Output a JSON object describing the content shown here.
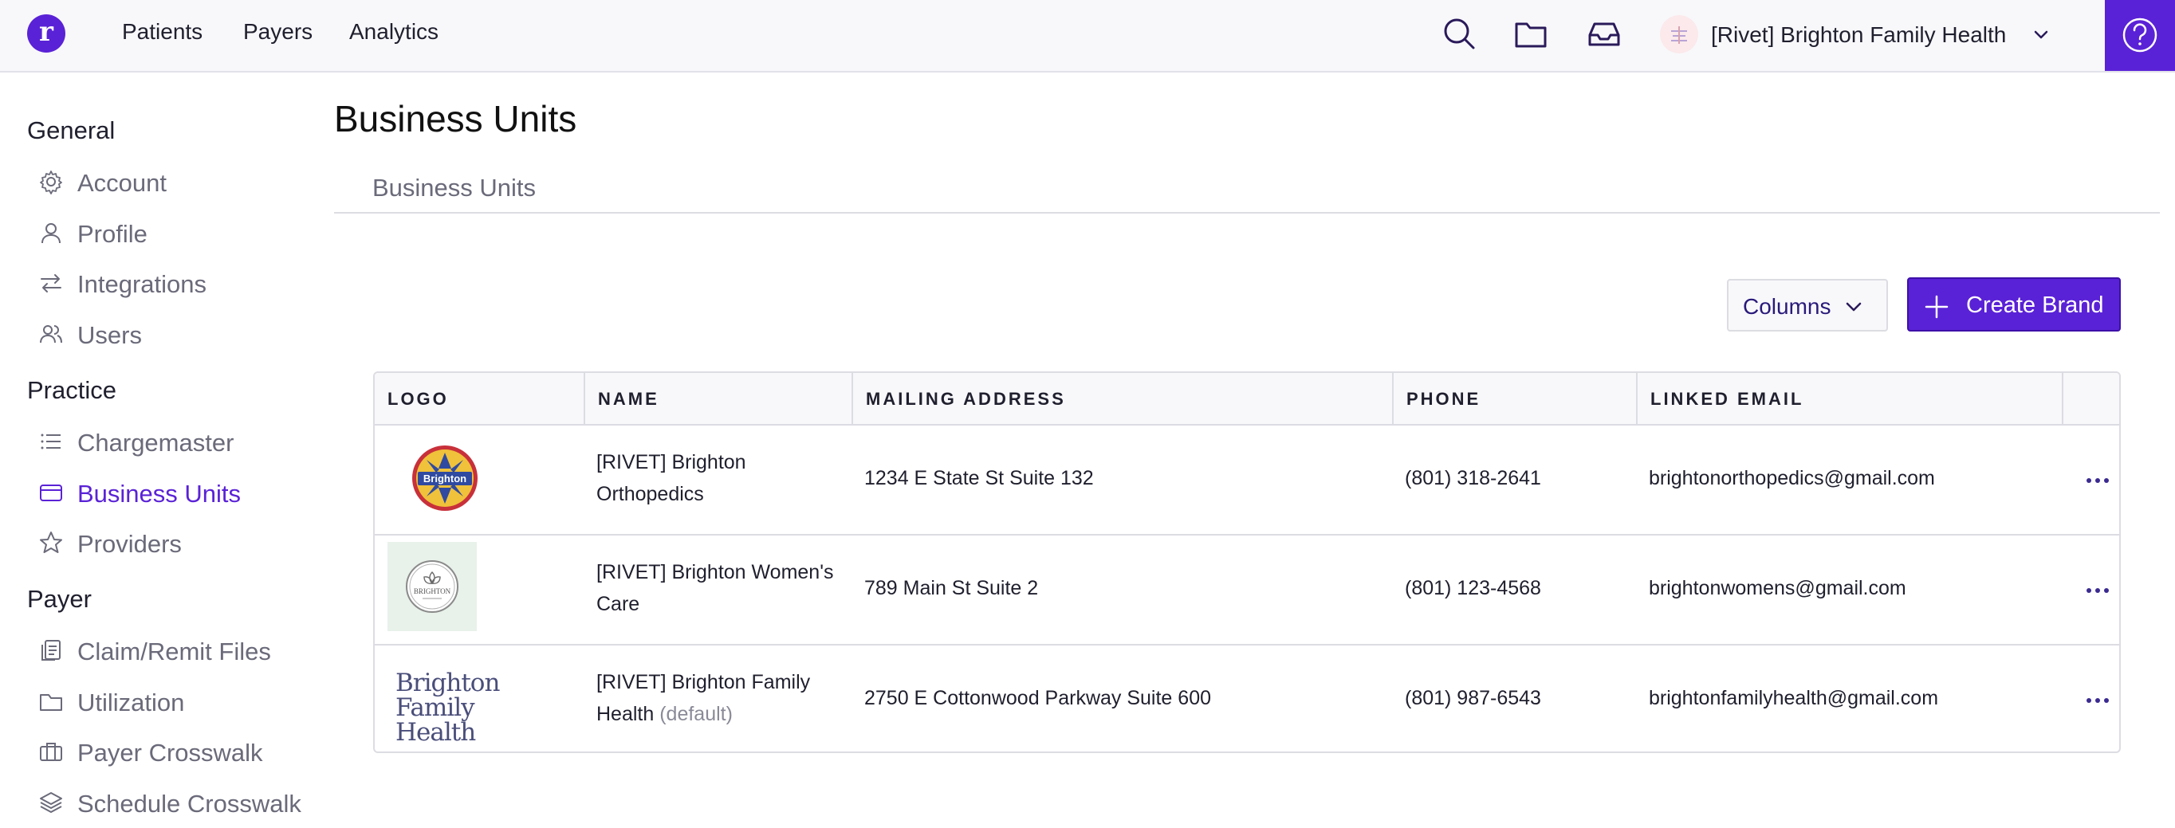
{
  "topbar": {
    "logo_letter": "r",
    "nav": [
      "Patients",
      "Payers",
      "Analytics"
    ],
    "icons": [
      "search-icon",
      "folder-icon",
      "inbox-icon"
    ],
    "org_name": "[Rivet] Brighton Family Health",
    "help_icon": "help-icon"
  },
  "sidebar": {
    "sections": [
      {
        "title": "General",
        "items": [
          {
            "label": "Account",
            "icon": "gear-icon"
          },
          {
            "label": "Profile",
            "icon": "user-icon"
          },
          {
            "label": "Integrations",
            "icon": "arrows-icon"
          },
          {
            "label": "Users",
            "icon": "users-icon"
          }
        ]
      },
      {
        "title": "Practice",
        "items": [
          {
            "label": "Chargemaster",
            "icon": "list-icon"
          },
          {
            "label": "Business Units",
            "icon": "card-icon",
            "active": true
          },
          {
            "label": "Providers",
            "icon": "star-icon"
          }
        ]
      },
      {
        "title": "Payer",
        "items": [
          {
            "label": "Claim/Remit Files",
            "icon": "files-icon"
          },
          {
            "label": "Utilization",
            "icon": "folder-icon"
          },
          {
            "label": "Payer Crosswalk",
            "icon": "briefcase-icon"
          },
          {
            "label": "Schedule Crosswalk",
            "icon": "layers-icon"
          }
        ]
      }
    ]
  },
  "main": {
    "title": "Business Units",
    "tab": "Business Units",
    "columns_button": "Columns",
    "create_button": "Create Brand",
    "table": {
      "headers": [
        "LOGO",
        "NAME",
        "MAILING ADDRESS",
        "PHONE",
        "LINKED EMAIL"
      ],
      "rows": [
        {
          "name_line1": "[RIVET] Brighton",
          "name_line2": "Orthopedics",
          "name_suffix": "",
          "address": "1234 E State St Suite 132",
          "phone": "(801) 318-2641",
          "email": "brightonorthopedics@gmail.com",
          "logo_text": "Brighton"
        },
        {
          "name_line1": "[RIVET] Brighton Women's",
          "name_line2": "Care",
          "name_suffix": "",
          "address": "789 Main St Suite 2",
          "phone": "(801) 123-4568",
          "email": "brightonwomens@gmail.com",
          "logo_text": "BRIGHTON"
        },
        {
          "name_line1": "[RIVET] Brighton Family",
          "name_line2": "Health",
          "name_suffix": "(default)",
          "address": "2750 E Cottonwood Parkway Suite 600",
          "phone": "(801) 987-6543",
          "email": "brightonfamilyhealth@gmail.com",
          "logo_text": "Brighton Family Health"
        }
      ]
    }
  },
  "colors": {
    "accent": "#5a22d6",
    "muted_text": "#6a6a7a",
    "border": "#dcdce3"
  }
}
